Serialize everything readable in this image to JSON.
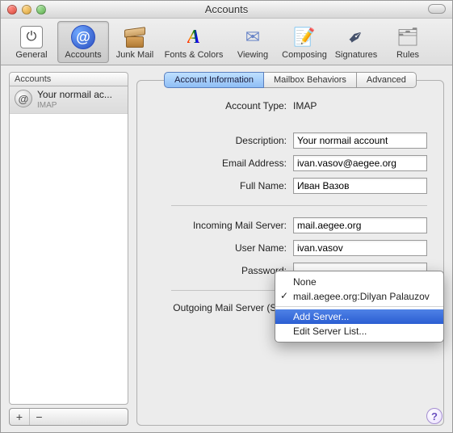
{
  "window": {
    "title": "Accounts"
  },
  "toolbar": {
    "items": [
      {
        "label": "General"
      },
      {
        "label": "Accounts"
      },
      {
        "label": "Junk Mail"
      },
      {
        "label": "Fonts & Colors"
      },
      {
        "label": "Viewing"
      },
      {
        "label": "Composing"
      },
      {
        "label": "Signatures"
      },
      {
        "label": "Rules"
      }
    ]
  },
  "sidebar": {
    "header": "Accounts",
    "accounts": [
      {
        "name": "Your normail ac...",
        "protocol": "IMAP"
      }
    ],
    "add_glyph": "+",
    "remove_glyph": "−"
  },
  "tabs": {
    "items": [
      {
        "label": "Account Information"
      },
      {
        "label": "Mailbox Behaviors"
      },
      {
        "label": "Advanced"
      }
    ]
  },
  "form": {
    "account_type": {
      "label": "Account Type:",
      "value": "IMAP"
    },
    "description": {
      "label": "Description:",
      "value": "Your normail account"
    },
    "email": {
      "label": "Email Address:",
      "value": "ivan.vasov@aegee.org"
    },
    "full_name": {
      "label": "Full Name:",
      "value": "Иван Вазов"
    },
    "incoming": {
      "label": "Incoming Mail Server:",
      "value": "mail.aegee.org"
    },
    "username": {
      "label": "User Name:",
      "value": "ivan.vasov"
    },
    "password": {
      "label": "Password:",
      "value": ""
    },
    "smtp": {
      "label": "Outgoing Mail Server (SMTP):"
    }
  },
  "smtp_popup": {
    "none": "None",
    "checked": "mail.aegee.org:Dilyan Palauzov",
    "add": "Add Server...",
    "edit": "Edit Server List..."
  },
  "help_glyph": "?"
}
